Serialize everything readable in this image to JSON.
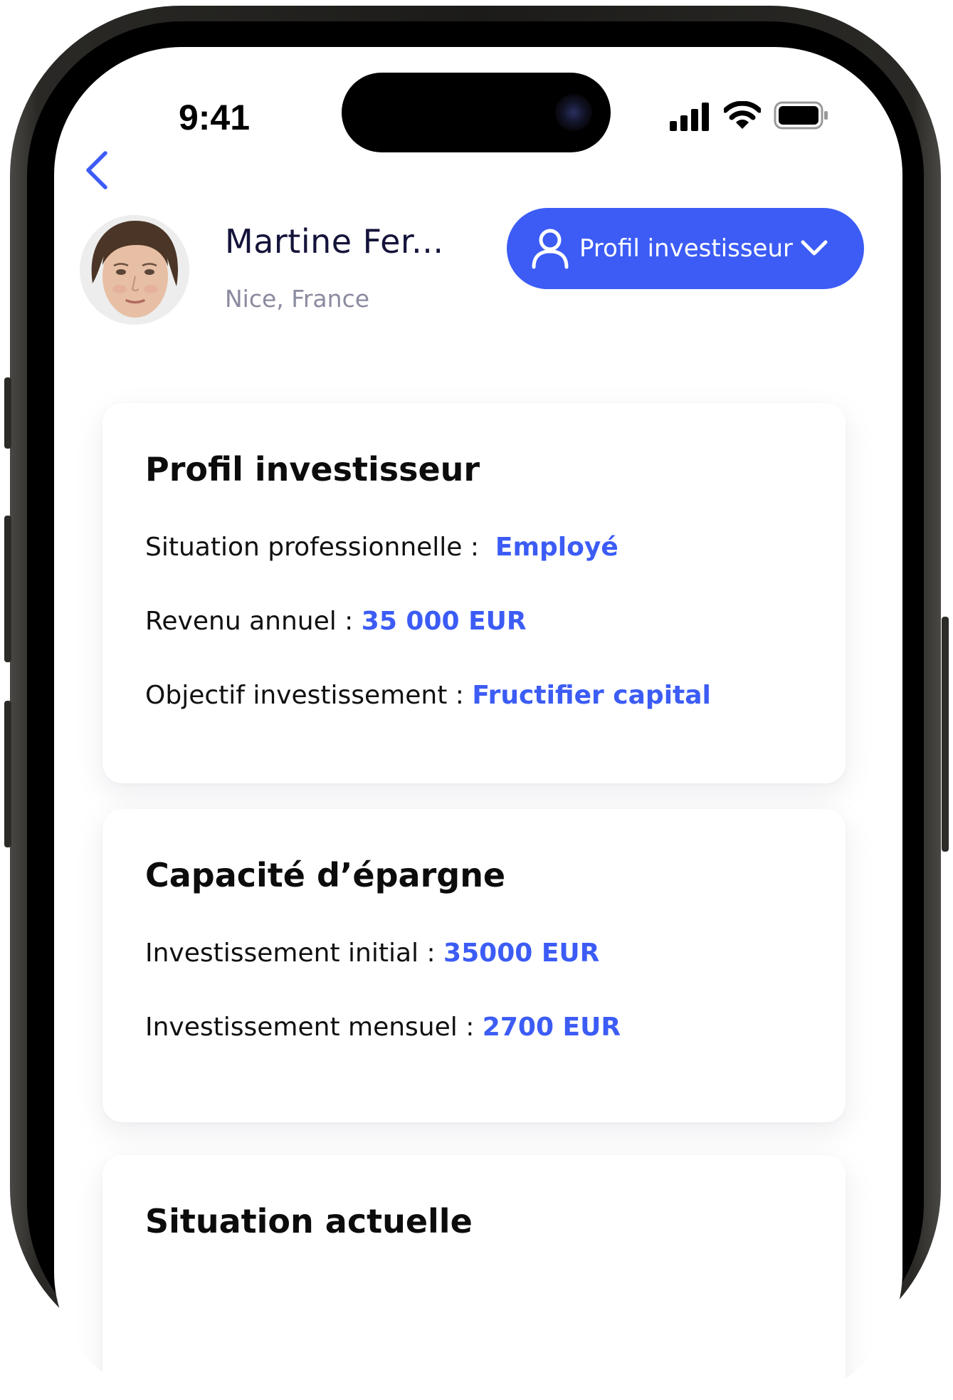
{
  "status_bar": {
    "time": "9:41"
  },
  "profile": {
    "name": "Martine Fer...",
    "location": "Nice, France",
    "switcher_label": "Profil investisseur"
  },
  "cards": {
    "investor": {
      "title": "Profil investisseur",
      "situation_label": "Situation professionnelle :",
      "situation_value": "Employé",
      "income_label": "Revenu annuel  :",
      "income_value": "35 000 EUR",
      "goal_label": "Objectif investissement :",
      "goal_value": "Fructifier capital"
    },
    "savings": {
      "title": "Capacité d’épargne",
      "initial_label": "Investissement initial :",
      "initial_value": "35000 EUR",
      "monthly_label": "Investissement mensuel :",
      "monthly_value": "2700 EUR"
    },
    "current": {
      "title": "Situation actuelle"
    }
  },
  "colors": {
    "accent": "#3c5cf5",
    "name_text": "#14133a",
    "secondary_text": "#8a8aa0"
  },
  "icons": {
    "back": "chevron-left-icon",
    "profile_switcher": "user-icon",
    "dropdown": "chevron-down-icon"
  }
}
